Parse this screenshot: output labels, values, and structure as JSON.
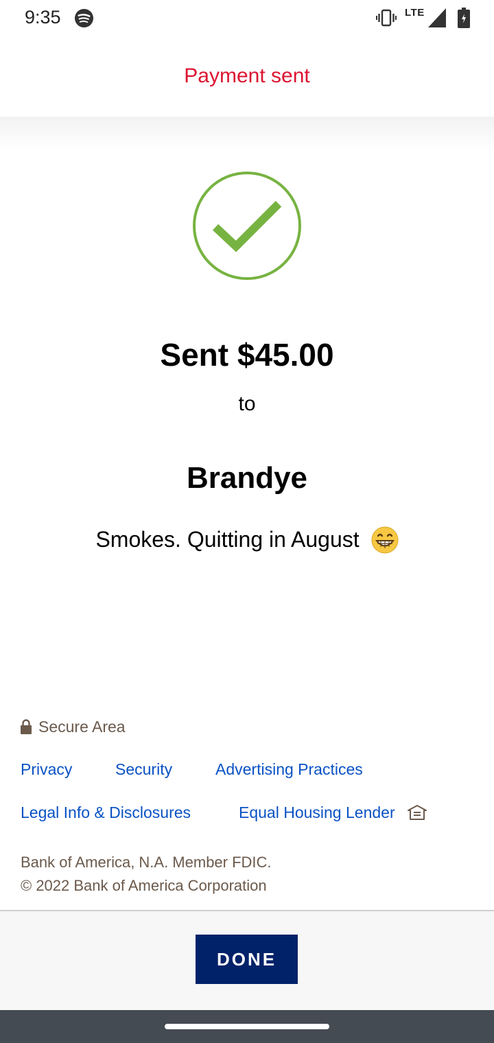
{
  "status_bar": {
    "time": "9:35",
    "network": "LTE",
    "icons": [
      "spotify-icon",
      "vibrate-icon",
      "signal-icon",
      "battery-icon"
    ]
  },
  "header": {
    "title": "Payment sent"
  },
  "confirmation": {
    "icon": "check-circle-icon",
    "amount_text": "Sent $45.00",
    "to_text": "to",
    "recipient": "Brandye",
    "memo": "Smokes. Quitting in August",
    "memo_emoji": "grinning-face-icon"
  },
  "footer": {
    "secure_label": "Secure Area",
    "links": {
      "privacy": "Privacy",
      "security": "Security",
      "advertising": "Advertising Practices",
      "legal": "Legal Info & Disclosures",
      "housing": "Equal Housing Lender"
    },
    "legal_line_1": "Bank of America, N.A. Member FDIC.",
    "legal_line_2": "© 2022 Bank of America Corporation"
  },
  "actions": {
    "done_label": "DONE"
  },
  "colors": {
    "header_title": "#dc1431",
    "check": "#77b341",
    "link": "#0a52c4",
    "done_button": "#012169",
    "footer_text": "#6b5a4c",
    "nav_bar": "#454b53"
  }
}
